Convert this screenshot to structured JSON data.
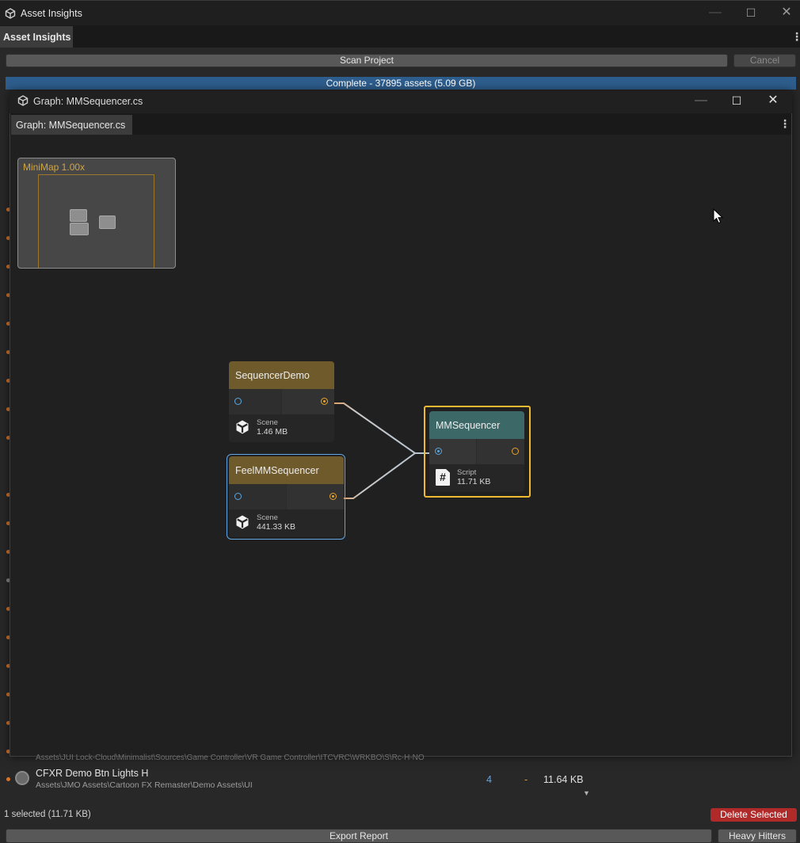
{
  "main_window": {
    "title": "Asset Insights",
    "tab": "Asset Insights",
    "controls": {
      "minimize": "—",
      "maximize": "☐",
      "close": "✕"
    },
    "menu_icon": "⋮"
  },
  "toolbar": {
    "scan_label": "Scan Project",
    "cancel_label": "Cancel"
  },
  "progress": {
    "text": "Complete - 37895 assets (5.09 GB)",
    "fraction": 1.0,
    "color": "#2e5e8e"
  },
  "graph_window": {
    "title": "Graph: MMSequencer.cs",
    "tab": "Graph: MMSequencer.cs",
    "controls": {
      "minimize": "—",
      "maximize": "☐",
      "close": "✕"
    },
    "menu_icon": "⋮",
    "minimap": {
      "label": "MiniMap  1.00x"
    },
    "nodes": [
      {
        "id": "seq",
        "title": "SequencerDemo",
        "type": "Scene",
        "size": "1.46 MB",
        "icon": "unity-logo-icon"
      },
      {
        "id": "feel",
        "title": "FeelMMSequencer",
        "type": "Scene",
        "size": "441.33 KB",
        "icon": "unity-logo-icon"
      },
      {
        "id": "mm",
        "title": "MMSequencer",
        "type": "Script",
        "size": "11.71 KB",
        "icon": "script-hash-icon",
        "icon_glyph": "#"
      }
    ]
  },
  "list": {
    "row": {
      "name": "CFXR Demo Btn Lights H",
      "path": "Assets\\JMO Assets\\Cartoon FX Remaster\\Demo Assets\\UI",
      "count": "4",
      "dash": "-",
      "size": "11.64 KB"
    },
    "partial_path_above": "Assets\\JUI Lock-Cloud\\Minimalist\\Sources\\Game Controller\\VR Game Controller\\ITCVRC\\WRKBO\\S\\Rc-H-NO"
  },
  "status": {
    "selected_text": "1 selected (11.71 KB)"
  },
  "buttons": {
    "delete_label": "Delete Selected",
    "export_label": "Export Report",
    "heavy_label": "Heavy Hitters"
  },
  "colors": {
    "scene_header": "#6e5a2a",
    "script_header": "#3d6868",
    "selected_outline": "#f0b932",
    "hover_outline": "#62a8e6",
    "input_port": "#5aa7e0",
    "output_port": "#e6a22a",
    "delete_button": "#b02a2a"
  }
}
